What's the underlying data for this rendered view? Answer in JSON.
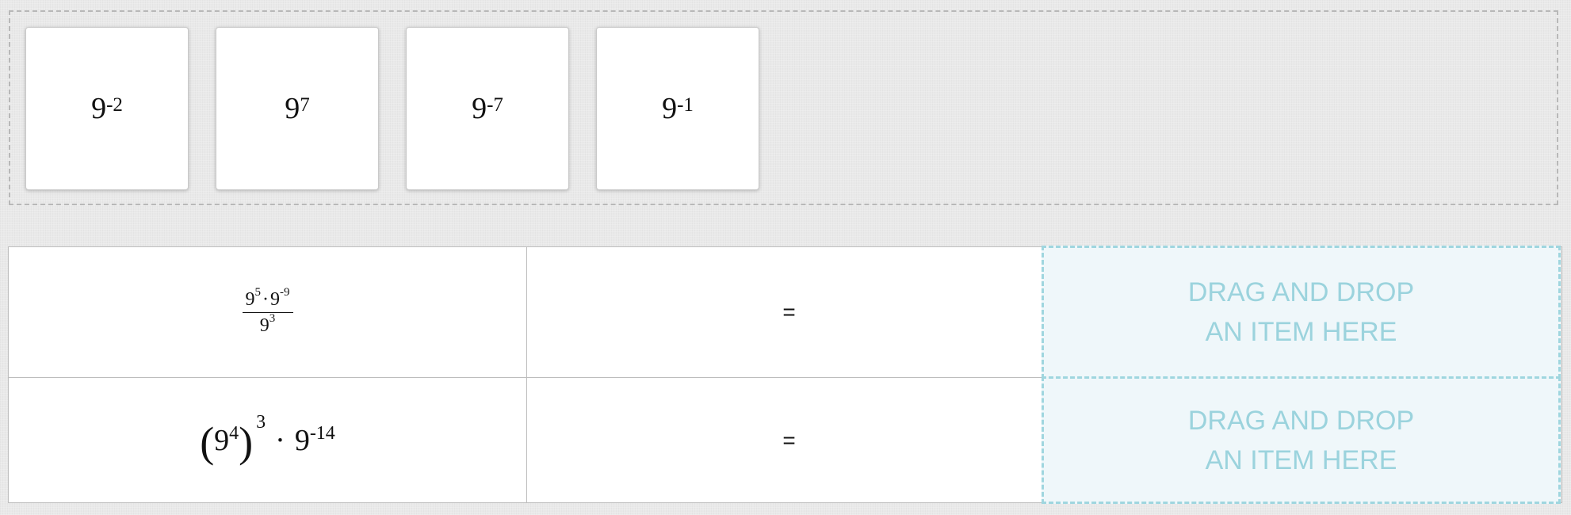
{
  "tiles": [
    {
      "base": "9",
      "exp": "-2"
    },
    {
      "base": "9",
      "exp": "7"
    },
    {
      "base": "9",
      "exp": "-7"
    },
    {
      "base": "9",
      "exp": "-1"
    }
  ],
  "rows": [
    {
      "expr": {
        "num_a_base": "9",
        "num_a_exp": "5",
        "dot": "·",
        "num_b_base": "9",
        "num_b_exp": "-9",
        "den_base": "9",
        "den_exp": "3"
      },
      "equals": "=",
      "drop_line1": "DRAG AND DROP",
      "drop_line2": "AN ITEM HERE"
    },
    {
      "expr": {
        "open_paren": "(",
        "inner_base": "9",
        "inner_exp": "4",
        "close_paren": ")",
        "outer_exp": "3",
        "dot": "·",
        "term_base": "9",
        "term_exp": "-14"
      },
      "equals": "=",
      "drop_line1": "DRAG AND DROP",
      "drop_line2": "AN ITEM HERE"
    }
  ],
  "colors": {
    "drop_border": "#9fd6df",
    "drop_text": "#9bd3dd",
    "drop_background": "#eff7fa"
  }
}
